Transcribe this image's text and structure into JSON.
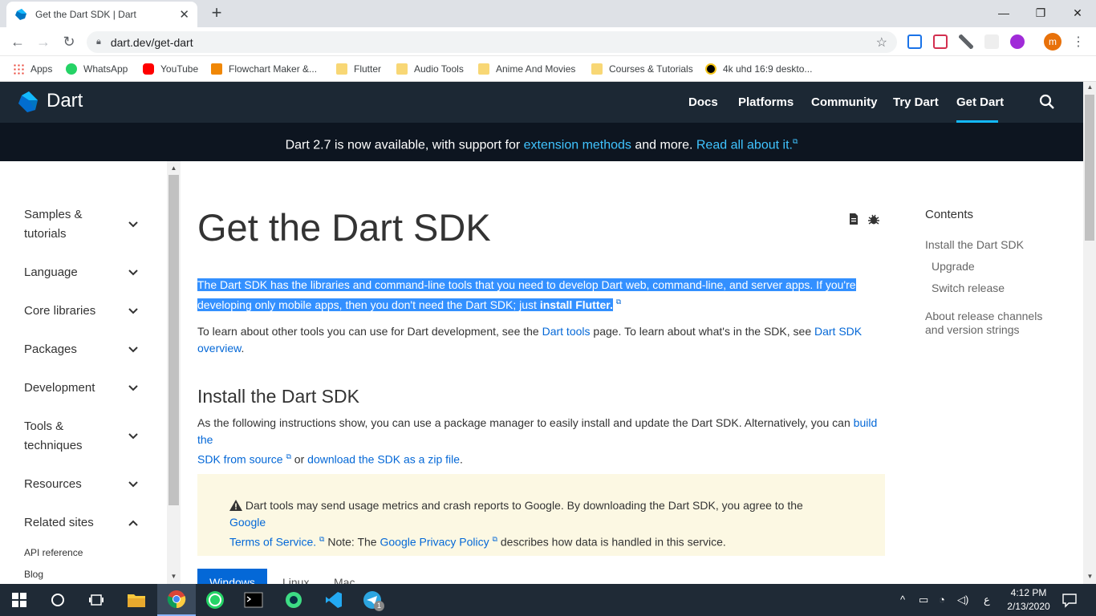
{
  "browser": {
    "tab_title": "Get the Dart SDK | Dart",
    "tab_close": "✕",
    "new_tab": "+",
    "url": "dart.dev/get-dart",
    "window_controls": [
      "—",
      "❐",
      "✕"
    ],
    "avatar_letter": "m",
    "bookmarks": [
      {
        "label": "Apps",
        "icon": "apps-grid-icon"
      },
      {
        "label": "WhatsApp",
        "icon": "whatsapp-icon"
      },
      {
        "label": "YouTube",
        "icon": "youtube-icon"
      },
      {
        "label": "Flowchart Maker &...",
        "icon": "flowchart-icon"
      },
      {
        "label": "Flutter",
        "icon": "folder-icon"
      },
      {
        "label": "Audio Tools",
        "icon": "folder-icon"
      },
      {
        "label": "Anime And Movies",
        "icon": "folder-icon"
      },
      {
        "label": "Courses & Tutorials",
        "icon": "folder-icon"
      },
      {
        "label": "4k uhd 16:9 deskto...",
        "icon": "wallpaper-icon"
      }
    ]
  },
  "site": {
    "logo_text": "Dart",
    "nav": [
      "Docs",
      "Platforms",
      "Community",
      "Try Dart",
      "Get Dart"
    ],
    "active_nav": "Get Dart",
    "banner": {
      "pre": "Dart 2.7 is now available, with support for ",
      "link1": "extension methods",
      "mid": " and more. ",
      "link2": "Read all about it."
    }
  },
  "sidebar": {
    "items": [
      {
        "label": "Samples & tutorials",
        "chevron": "down"
      },
      {
        "label": "Language",
        "chevron": "down"
      },
      {
        "label": "Core libraries",
        "chevron": "down"
      },
      {
        "label": "Packages",
        "chevron": "down"
      },
      {
        "label": "Development",
        "chevron": "down"
      },
      {
        "label": "Tools & techniques",
        "chevron": "down"
      },
      {
        "label": "Resources",
        "chevron": "down"
      },
      {
        "label": "Related sites",
        "chevron": "up"
      }
    ],
    "sublinks": [
      "API reference",
      "Blog"
    ]
  },
  "main": {
    "title": "Get the Dart SDK",
    "intro_line1": "The Dart SDK has the libraries and command-line tools that you need to develop Dart web, command-line, and server apps. If you're",
    "intro_line2a": "developing only mobile apps, then you don't need the Dart SDK; just ",
    "intro_link": "install Flutter.",
    "tools_pre": "To learn about other tools you can use for Dart development, see the ",
    "tools_link": "Dart tools",
    "tools_mid": " page. To learn about what's in the SDK, see ",
    "tools_link2a": "Dart SDK",
    "tools_link2b": "overview",
    "tools_end": ".",
    "h2": "Install the Dart SDK",
    "install_pre": "As the following instructions show, you can use a package manager to easily install and update the Dart SDK. Alternatively, you can ",
    "install_link1a": "build the",
    "install_link1b": "SDK from source",
    "install_mid": " or ",
    "install_link2": "download the SDK as a zip file",
    "install_end": ".",
    "notice_pre": "Dart tools may send usage metrics and crash reports to Google. By downloading the Dart SDK, you agree to the ",
    "notice_link1a": "Google",
    "notice_link1b": "Terms of Service.",
    "notice_mid": " Note: The ",
    "notice_link2": "Google Privacy Policy",
    "notice_end": " describes how data is handled in this service.",
    "tabs": [
      "Windows",
      "Linux",
      "Mac"
    ]
  },
  "toc": {
    "title": "Contents",
    "items": [
      "Install the Dart SDK",
      "Upgrade",
      "Switch release",
      "About release channels and version strings"
    ]
  },
  "taskbar": {
    "time": "4:12 PM",
    "date": "2/13/2020",
    "lang": "ع",
    "telegram_badge": "1"
  }
}
